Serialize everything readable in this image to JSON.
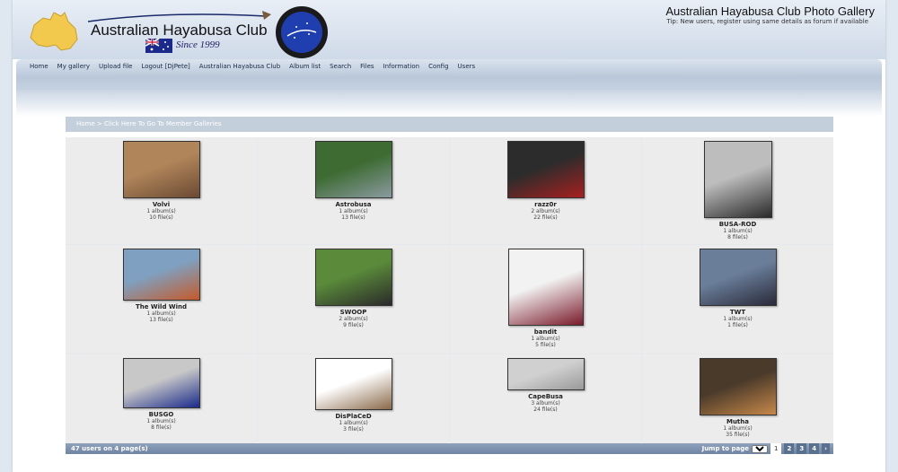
{
  "header": {
    "site_title": "Australian Hayabusa Club Photo Gallery",
    "tip": "Tip: New users, register using same details as forum if available",
    "logo_text": "Australian Hayabusa Club",
    "logo_since": "Since 1999"
  },
  "nav": {
    "items": [
      "Home",
      "My gallery",
      "Upload file",
      "Logout [DjPete]",
      "Australian Hayabusa Club",
      "Album list",
      "Search",
      "Files",
      "Information",
      "Config",
      "Users"
    ]
  },
  "breadcrumb": {
    "home": "Home",
    "separator": ">",
    "current": "Click Here To Go To Member Galleries"
  },
  "users": [
    {
      "name": "Volvi",
      "albums": "1 album(s)",
      "files": "10 file(s)",
      "thumb_colors": [
        "#b0855a",
        "#6b4a33"
      ]
    },
    {
      "name": "Astrobusa",
      "albums": "1 album(s)",
      "files": "13 file(s)",
      "thumb_colors": [
        "#3d6b32",
        "#8a9aa0"
      ]
    },
    {
      "name": "razz0r",
      "albums": "2 album(s)",
      "files": "22 file(s)",
      "thumb_colors": [
        "#2c2c2c",
        "#a82020"
      ]
    },
    {
      "name": "BUSA-ROD",
      "albums": "1 album(s)",
      "files": "8 file(s)",
      "thumb_colors": [
        "#bdbdbd",
        "#2a2a2a"
      ]
    },
    {
      "name": "The Wild Wind",
      "albums": "1 album(s)",
      "files": "13 file(s)",
      "thumb_colors": [
        "#7fa0c0",
        "#c45a2a"
      ]
    },
    {
      "name": "SWOOP",
      "albums": "2 album(s)",
      "files": "9 file(s)",
      "thumb_colors": [
        "#5a8a3a",
        "#2a2a2a"
      ]
    },
    {
      "name": "bandit",
      "albums": "1 album(s)",
      "files": "5 file(s)",
      "thumb_colors": [
        "#f2f2f2",
        "#7a1a2a"
      ]
    },
    {
      "name": "TWT",
      "albums": "1 album(s)",
      "files": "1 file(s)",
      "thumb_colors": [
        "#6a7e9a",
        "#2a2a3a"
      ]
    },
    {
      "name": "BUSGO",
      "albums": "1 album(s)",
      "files": "8 file(s)",
      "thumb_colors": [
        "#c8c8c8",
        "#1a2a8a"
      ]
    },
    {
      "name": "DisPlaCeD",
      "albums": "1 album(s)",
      "files": "3 file(s)",
      "thumb_colors": [
        "#ffffff",
        "#8a6a4a"
      ]
    },
    {
      "name": "CapeBusa",
      "albums": "3 album(s)",
      "files": "24 file(s)",
      "thumb_colors": [
        "#d0d0d0",
        "#9a9a9a"
      ]
    },
    {
      "name": "Mutha",
      "albums": "1 album(s)",
      "files": "35 file(s)",
      "thumb_colors": [
        "#4a3a2a",
        "#c8884a"
      ]
    }
  ],
  "footer": {
    "count": "47 users on 4 page(s)",
    "jump_label": "Jump to page",
    "jump_value": "1",
    "pages": [
      "1",
      "2",
      "3",
      "4"
    ],
    "next": "›"
  }
}
